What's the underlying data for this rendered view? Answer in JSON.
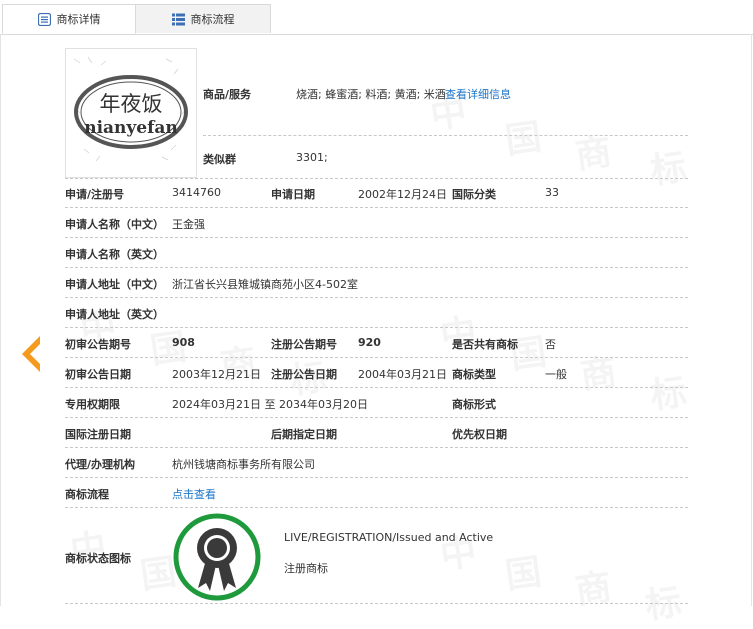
{
  "tabs": [
    {
      "label": "商标详情",
      "icon": "detail-list-icon",
      "active": true
    },
    {
      "label": "商标流程",
      "icon": "process-grid-icon",
      "active": false
    }
  ],
  "logo": {
    "line1": "年夜饭",
    "line2": "nianyefan"
  },
  "goods": {
    "label": "商品/服务",
    "value": "烧酒; 蜂蜜酒; 料酒; 黄酒; 米酒",
    "link": "查看详细信息"
  },
  "similar": {
    "label": "类似群",
    "value": "3301;"
  },
  "reg": {
    "reg_no_label": "申请/注册号",
    "reg_no": "3414760",
    "app_date_label": "申请日期",
    "app_date": "2002年12月24日",
    "intl_class_label": "国际分类",
    "intl_class": "33"
  },
  "applicant_cn": {
    "label": "申请人名称（中文）",
    "value": "王金强"
  },
  "applicant_en": {
    "label": "申请人名称（英文）",
    "value": ""
  },
  "address_cn": {
    "label": "申请人地址（中文）",
    "value": "浙江省长兴县雉城镇商苑小区4-502室"
  },
  "address_en": {
    "label": "申请人地址（英文）",
    "value": ""
  },
  "pub": {
    "prelim_no_label": "初审公告期号",
    "prelim_no": "908",
    "reg_pub_no_label": "注册公告期号",
    "reg_pub_no": "920",
    "shared_label": "是否共有商标",
    "shared": "否"
  },
  "pub_dates": {
    "prelim_date_label": "初审公告日期",
    "prelim_date": "2003年12月21日",
    "reg_pub_date_label": "注册公告日期",
    "reg_pub_date": "2004年03月21日",
    "type_label": "商标类型",
    "type": "一般"
  },
  "rights": {
    "label": "专用权期限",
    "value": "2024年03月21日 至 2034年03月20日",
    "form_label": "商标形式"
  },
  "intl": {
    "label": "国际注册日期",
    "later_label": "后期指定日期",
    "priority_label": "优先权日期"
  },
  "agent": {
    "label": "代理/办理机构",
    "value": "杭州钱塘商标事务所有限公司"
  },
  "flow": {
    "label": "商标流程",
    "link": "点击查看"
  },
  "status": {
    "label": "商标状态图标",
    "en": "LIVE/REGISTRATION/Issued and Active",
    "cn": "注册商标",
    "ring_color": "#1e9a3c",
    "medal_color": "#3a3a3a"
  },
  "watermark": [
    "中",
    "国",
    "商",
    "标"
  ],
  "colors": {
    "link": "#1a73c8",
    "arrow": "#f59a1e",
    "tab_icon": "#3d6fb4"
  }
}
